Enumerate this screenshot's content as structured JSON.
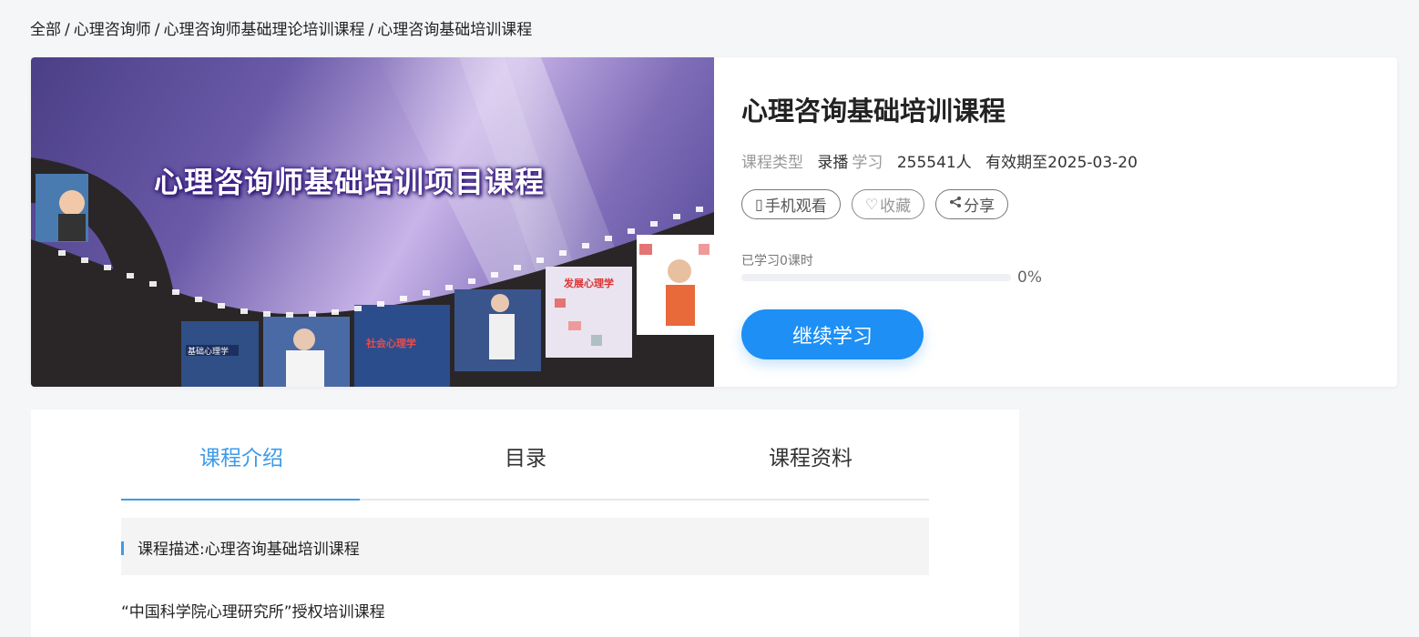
{
  "breadcrumb": {
    "items": [
      "全部",
      "心理咨询师",
      "心理咨询师基础理论培训课程",
      "心理咨询基础培训课程"
    ],
    "separator": "/"
  },
  "cover": {
    "title": "心理咨询师基础培训项目课程",
    "film_labels": [
      "基础心理学",
      "社会心理学",
      "发展心理学"
    ]
  },
  "course": {
    "title": "心理咨询基础培训课程",
    "type_label": "课程类型",
    "mode": "录播",
    "mode_sub": "学习",
    "learners": "255541人",
    "expiry": "有效期至2025-03-20"
  },
  "actions": {
    "mobile_label": "手机观看",
    "collect_label": "收藏",
    "share_label": "分享"
  },
  "progress": {
    "label": "已学习0课时",
    "percent_text": "0%",
    "value": 0
  },
  "continue_label": "继续学习",
  "tabs": {
    "intro": "课程介绍",
    "catalog": "目录",
    "materials": "课程资料"
  },
  "description": {
    "label": "课程描述:心理咨询基础培训课程",
    "authorization": "“中国科学院心理研究所”授权培训课程"
  },
  "colors": {
    "accent": "#3d9be9",
    "button": "#1e8ff5"
  }
}
